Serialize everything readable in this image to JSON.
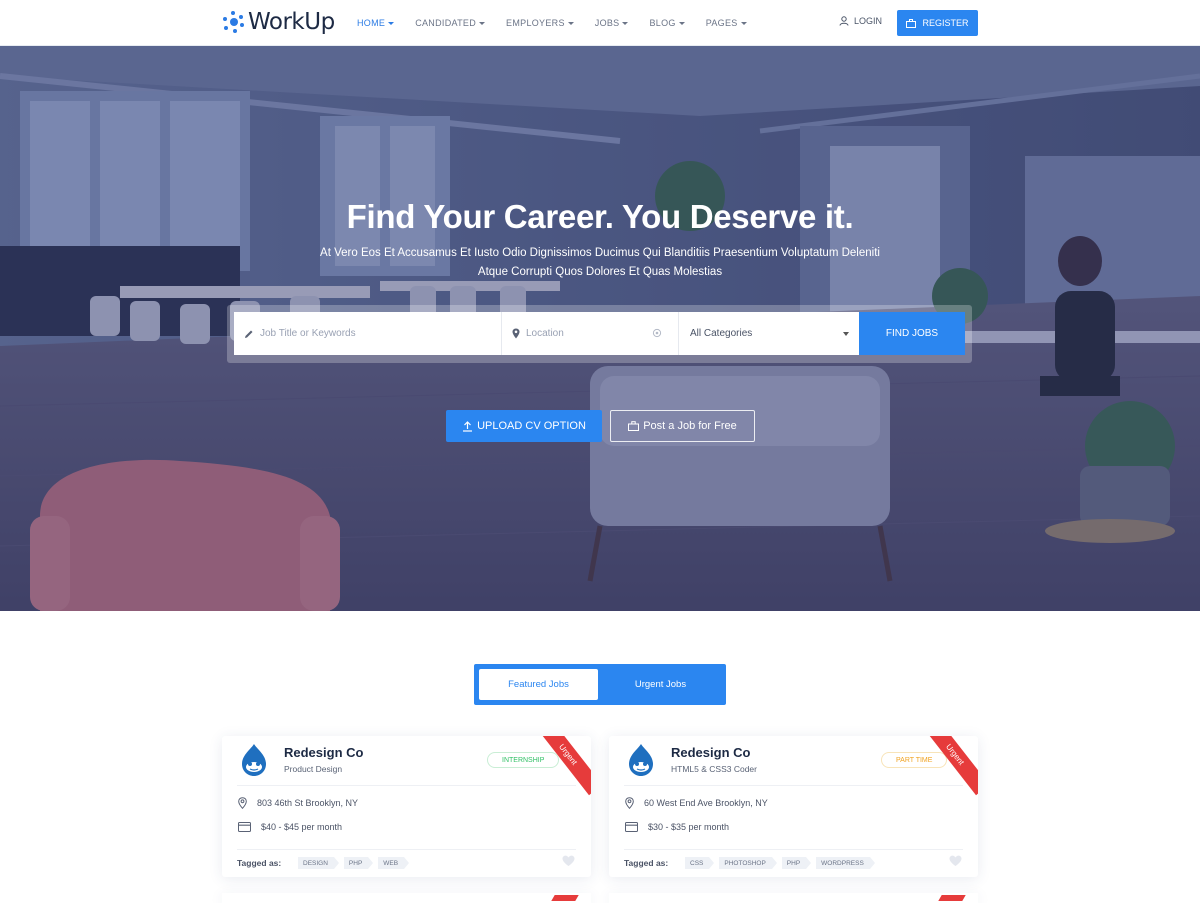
{
  "brand": {
    "name": "WorkUp",
    "accent": "#2b86f0"
  },
  "nav": {
    "items": [
      {
        "label": "HOME",
        "active": true
      },
      {
        "label": "CANDIDATED",
        "active": false
      },
      {
        "label": "EMPLOYERS",
        "active": false
      },
      {
        "label": "JOBS",
        "active": false
      },
      {
        "label": "BLOG",
        "active": false
      },
      {
        "label": "PAGES",
        "active": false
      }
    ],
    "login": "LOGIN",
    "register": "REGISTER"
  },
  "hero": {
    "title": "Find Your Career. You Deserve it.",
    "subtitle_line1": "At Vero Eos Et Accusamus Et Iusto Odio Dignissimos Ducimus Qui Blanditiis Praesentium Voluptatum Deleniti",
    "subtitle_line2": "Atque Corrupti Quos Dolores Et Quas Molestias"
  },
  "search": {
    "keywords_placeholder": "Job Title or Keywords",
    "location_placeholder": "Location",
    "category_selected": "All Categories",
    "find_button": "FIND JOBS"
  },
  "actions": {
    "upload_cv": "UPLOAD CV OPTION",
    "post_job": "Post a Job for Free"
  },
  "tabs": {
    "featured": "Featured Jobs",
    "urgent": "Urgent Jobs"
  },
  "jobs": [
    {
      "company": "Redesign Co",
      "role": "Product Design",
      "type": "INTERNSHIP",
      "ribbon": "Urgent",
      "address": "803 46th St Brooklyn, NY",
      "salary": "$40 - $45 per month",
      "tagged_label": "Tagged as:",
      "tags": [
        "DESIGN",
        "PHP",
        "WEB"
      ]
    },
    {
      "company": "Redesign Co",
      "role": "HTML5 & CSS3 Coder",
      "type": "PART TIME",
      "ribbon": "Urgent",
      "address": "60 West End Ave Brooklyn, NY",
      "salary": "$30 - $35 per month",
      "tagged_label": "Tagged as:",
      "tags": [
        "CSS",
        "PHOTOSHOP",
        "PHP",
        "WORDPRESS"
      ]
    }
  ]
}
